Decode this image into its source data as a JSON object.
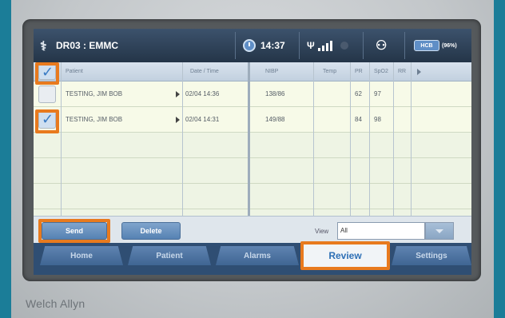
{
  "status_bar": {
    "device_name": "DR03 : EMMC",
    "time": "14:37",
    "battery_label": "HCB",
    "battery_percent": "(96%)"
  },
  "table": {
    "headers": [
      "Patient",
      "Date / Time",
      "NIBP",
      "Temp",
      "PR",
      "SpO2",
      "RR"
    ],
    "rows": [
      {
        "checked": false,
        "patient": "TESTING, JIM BOB",
        "datetime": "02/04  14:36",
        "nibp": "138/86",
        "temp": "",
        "pr": "62",
        "spo2": "97"
      },
      {
        "checked": true,
        "patient": "TESTING, JIM BOB",
        "datetime": "02/04  14:31",
        "nibp": "149/88",
        "temp": "",
        "pr": "84",
        "spo2": "98"
      }
    ],
    "header_checked": true
  },
  "controls": {
    "send_label": "Send",
    "delete_label": "Delete",
    "view_label": "View",
    "view_value": "All"
  },
  "tabs": {
    "home": "Home",
    "patient": "Patient",
    "alarms": "Alarms",
    "review": "Review",
    "settings": "Settings",
    "active": "Review"
  },
  "branding": {
    "manufacturer": "Welch Allyn"
  },
  "colors": {
    "highlight": "#e87a1e",
    "active_tab_text": "#2d6fb5",
    "teal_frame": "#1b7d98"
  }
}
